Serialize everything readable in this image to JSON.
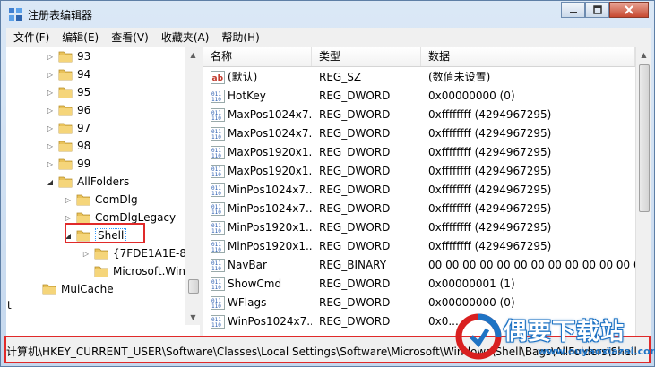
{
  "window": {
    "title": "注册表编辑器"
  },
  "menu": [
    "文件(F)",
    "编辑(E)",
    "查看(V)",
    "收藏夹(A)",
    "帮助(H)"
  ],
  "tree": [
    {
      "label": "93",
      "indent": 1,
      "expander": "right"
    },
    {
      "label": "94",
      "indent": 1,
      "expander": "right"
    },
    {
      "label": "95",
      "indent": 1,
      "expander": "right"
    },
    {
      "label": "96",
      "indent": 1,
      "expander": "right"
    },
    {
      "label": "97",
      "indent": 1,
      "expander": "right"
    },
    {
      "label": "98",
      "indent": 1,
      "expander": "right"
    },
    {
      "label": "99",
      "indent": 1,
      "expander": "right"
    },
    {
      "label": "AllFolders",
      "indent": 1,
      "expander": "down"
    },
    {
      "label": "ComDlg",
      "indent": 2,
      "expander": "right"
    },
    {
      "label": "ComDlgLegacy",
      "indent": 2,
      "expander": "right"
    },
    {
      "label": "Shell",
      "indent": 2,
      "expander": "down",
      "selected": true
    },
    {
      "label": "{7FDE1A1E-8B",
      "indent": 3,
      "expander": "right"
    },
    {
      "label": "Microsoft.Wind",
      "indent": 3,
      "expander": ""
    },
    {
      "label": "MuiCache",
      "indent": 0,
      "expander": ""
    }
  ],
  "tree_fragment": "t",
  "columns": {
    "name": "名称",
    "type": "类型",
    "data": "数据"
  },
  "values": [
    {
      "icon": "string",
      "name": "(默认)",
      "type": "REG_SZ",
      "data": "(数值未设置)"
    },
    {
      "icon": "binary",
      "name": "HotKey",
      "type": "REG_DWORD",
      "data": "0x00000000 (0)"
    },
    {
      "icon": "binary",
      "name": "MaxPos1024x7...",
      "type": "REG_DWORD",
      "data": "0xffffffff (4294967295)"
    },
    {
      "icon": "binary",
      "name": "MaxPos1024x7...",
      "type": "REG_DWORD",
      "data": "0xffffffff (4294967295)"
    },
    {
      "icon": "binary",
      "name": "MaxPos1920x1...",
      "type": "REG_DWORD",
      "data": "0xffffffff (4294967295)"
    },
    {
      "icon": "binary",
      "name": "MaxPos1920x1...",
      "type": "REG_DWORD",
      "data": "0xffffffff (4294967295)"
    },
    {
      "icon": "binary",
      "name": "MinPos1024x7...",
      "type": "REG_DWORD",
      "data": "0xffffffff (4294967295)"
    },
    {
      "icon": "binary",
      "name": "MinPos1024x7...",
      "type": "REG_DWORD",
      "data": "0xffffffff (4294967295)"
    },
    {
      "icon": "binary",
      "name": "MinPos1920x1...",
      "type": "REG_DWORD",
      "data": "0xffffffff (4294967295)"
    },
    {
      "icon": "binary",
      "name": "MinPos1920x1...",
      "type": "REG_DWORD",
      "data": "0xffffffff (4294967295)"
    },
    {
      "icon": "binary",
      "name": "NavBar",
      "type": "REG_BINARY",
      "data": "00 00 00 00 00 00 00 00 00 00 00 00 00"
    },
    {
      "icon": "binary",
      "name": "ShowCmd",
      "type": "REG_DWORD",
      "data": "0x00000001 (1)"
    },
    {
      "icon": "binary",
      "name": "WFlags",
      "type": "REG_DWORD",
      "data": "0x00000000 (0)"
    },
    {
      "icon": "binary",
      "name": "WinPos1024x7...",
      "type": "REG_DWORD",
      "data": "0x0..."
    }
  ],
  "status": {
    "path": "计算机\\HKEY_CURRENT_USER\\Software\\Classes\\Local Settings\\Software\\Microsoft\\Windows\\Shell\\Bags\\AllFolders\\Shell"
  },
  "watermark": {
    "text": "偶要下载站",
    "url": "www.ouyaoxiazai.com"
  },
  "colors": {
    "folder": "#e9c25a",
    "highlight": "#e02a2a",
    "selection_focus": "#3399ff"
  }
}
